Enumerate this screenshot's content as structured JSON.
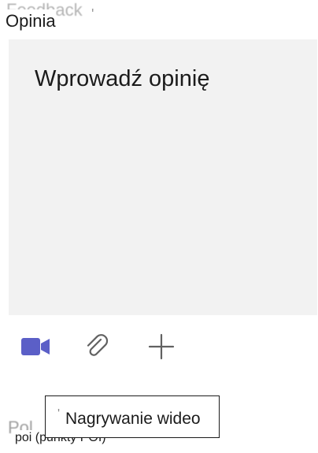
{
  "header": {
    "label": "Opinia"
  },
  "feedback": {
    "placeholder": "Wprowadź opinię"
  },
  "toolbar": {
    "video_icon": "video-camera-icon",
    "attach_icon": "paperclip-icon",
    "add_icon": "plus-icon",
    "accent_color": "#5b5fc7",
    "icon_color": "#616161"
  },
  "tooltip": {
    "text": "Nagrywanie wideo"
  },
  "footer": {
    "poi_text": "poi (punkty POI)"
  }
}
